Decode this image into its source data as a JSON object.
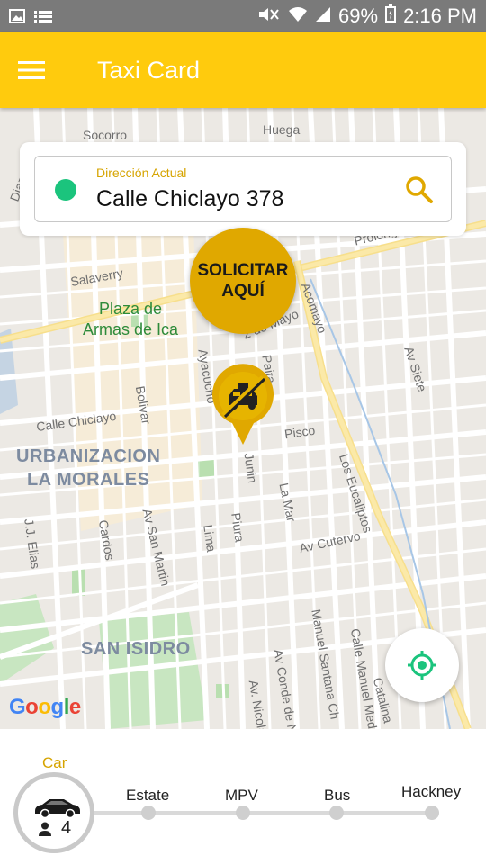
{
  "status_bar": {
    "battery": "69%",
    "time": "2:16 PM"
  },
  "app_bar": {
    "title": "Taxi Card"
  },
  "address": {
    "label": "Dirección Actual",
    "value": "Calle Chiclayo 378"
  },
  "request_button": {
    "line1": "SOLICITAR",
    "line2": "AQUÍ"
  },
  "map": {
    "labels": {
      "socorro": "Socorro",
      "huega": "Huega",
      "diaz": "Diaz",
      "salaverry": "Salaverry",
      "plaza": "Plaza de\nArmas de Ica",
      "prolong": "Prolong",
      "acomayo": "Acomayo",
      "dos_de_mayo": "2 de Mayo",
      "ayacucho": "Ayacucho",
      "bolivar": "Bolivar",
      "paita": "Paita",
      "av_siete": "Av Siete",
      "calle_chiclayo": "Calle Chiclayo",
      "pisco": "Pisco",
      "urbanizacion": "URBANIZACION\nLA MORALES",
      "junin": "Junin",
      "los_eucaliptos": "Los Eucaliptos",
      "jj_elias": "J.J. Elias",
      "cardos": "Cardos",
      "av_san_martin": "Av San Martin",
      "lima": "Lima",
      "piura": "Piura",
      "la_mar": "La Mar",
      "av_cutervo": "Av Cutervo",
      "san_isidro": "SAN ISIDRO",
      "manuel_santana": "Manuel Santana Ch",
      "calle_manuel": "Calle Manuel Med",
      "av_conde": "Av Conde de N",
      "av_nicola": "Av. Nicola",
      "catalina": "Catalina"
    },
    "attribution": "Google"
  },
  "vehicle_selector": {
    "selected": "Car",
    "seats": "4",
    "options": [
      "Estate",
      "MPV",
      "Bus",
      "Hackney"
    ]
  },
  "colors": {
    "primary": "#ffcb0d",
    "accent": "#e0a800",
    "green": "#1bc47d"
  }
}
